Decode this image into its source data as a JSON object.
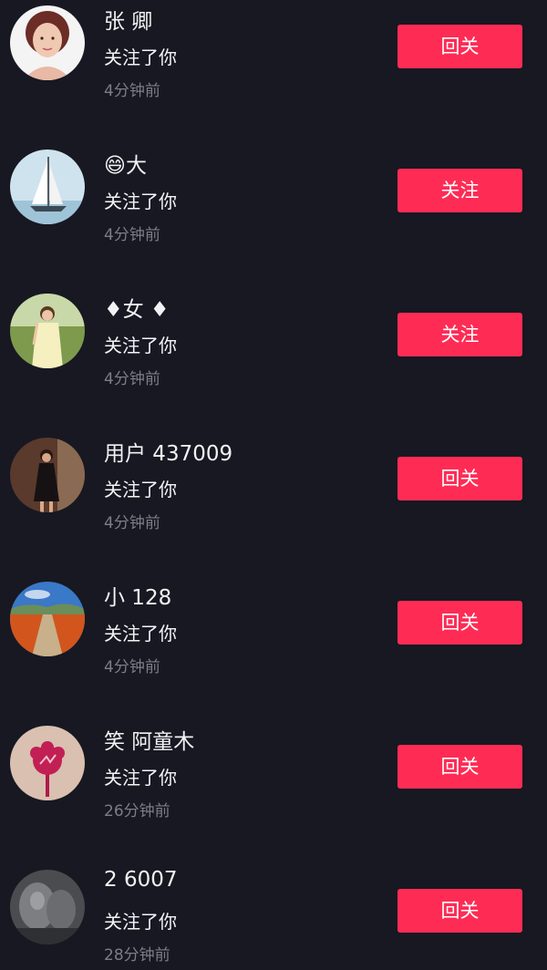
{
  "rows": [
    {
      "name": "张 卿",
      "action": "关注了你",
      "time": "4分钟前",
      "button": "回关",
      "avatar": "woman-portrait-avatar"
    },
    {
      "name": "😄大 ",
      "action": "关注了你",
      "time": "4分钟前",
      "button": "关注",
      "avatar": "sailboat-avatar"
    },
    {
      "name": "♦女 ♦",
      "action": "关注了你",
      "time": "4分钟前",
      "button": "关注",
      "avatar": "woman-yellow-dress-avatar"
    },
    {
      "name": "用户 437009",
      "action": "关注了你",
      "time": "4分钟前",
      "button": "回关",
      "avatar": "woman-black-dress-avatar"
    },
    {
      "name": "小 128",
      "action": "关注了你",
      "time": "4分钟前",
      "button": "回关",
      "avatar": "flower-field-landscape-avatar"
    },
    {
      "name": "笑 阿童木",
      "action": "关注了你",
      "time": "26分钟前",
      "button": "回关",
      "avatar": "red-flower-illustration-avatar"
    },
    {
      "name": "2 6007",
      "action": "关注了你",
      "time": "28分钟前",
      "button": "回关",
      "avatar": "gray-blurred-photo-avatar"
    }
  ],
  "colors": {
    "background": "#171821",
    "button": "#fe2c55",
    "primary_text": "#f2f2f4",
    "secondary_text": "#7b7d88"
  }
}
